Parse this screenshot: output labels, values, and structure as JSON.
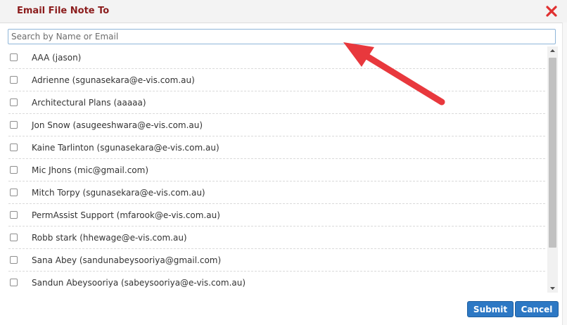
{
  "dialog": {
    "title": "Email File Note To",
    "close_icon": "close-x-icon",
    "search": {
      "placeholder": "Search by Name or Email",
      "value": ""
    },
    "recipients": [
      {
        "label": "AAA (jason)",
        "checked": false
      },
      {
        "label": "Adrienne (sgunasekara@e-vis.com.au)",
        "checked": false
      },
      {
        "label": "Architectural Plans (aaaaa)",
        "checked": false
      },
      {
        "label": "Jon Snow (asugeeshwara@e-vis.com.au)",
        "checked": false
      },
      {
        "label": "Kaine Tarlinton (sgunasekara@e-vis.com.au)",
        "checked": false
      },
      {
        "label": "Mic Jhons (mic@gmail.com)",
        "checked": false
      },
      {
        "label": "Mitch Torpy (sgunasekara@e-vis.com.au)",
        "checked": false
      },
      {
        "label": "PermAssist Support (mfarook@e-vis.com.au)",
        "checked": false
      },
      {
        "label": "Robb stark (hhewage@e-vis.com.au)",
        "checked": false
      },
      {
        "label": "Sana Abey (sandunabeysooriya@gmail.com)",
        "checked": false
      },
      {
        "label": "Sandun Abeysooriya (sabeysooriya@e-vis.com.au)",
        "checked": false
      }
    ],
    "buttons": {
      "submit": "Submit",
      "cancel": "Cancel"
    }
  },
  "colors": {
    "title": "#8b1c1c",
    "close_icon": "#e03030",
    "button": "#2d78c4",
    "annotation_arrow": "#e8383d"
  }
}
